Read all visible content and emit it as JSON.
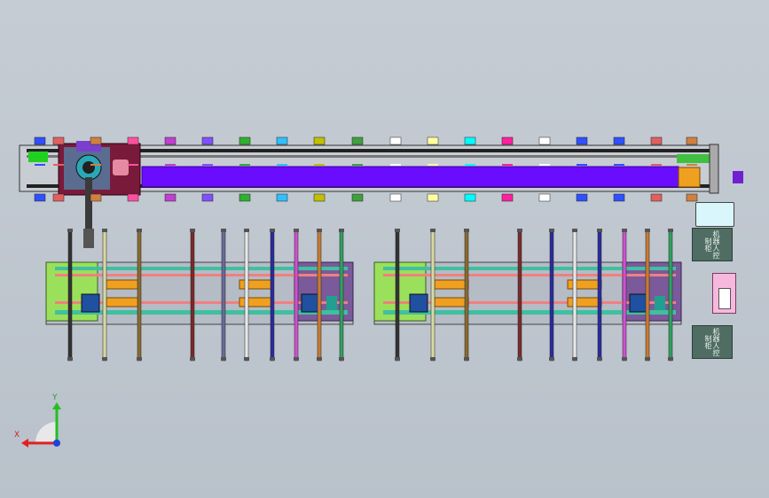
{
  "scene": {
    "type": "cad-plan-view",
    "background_color": "#bfc6ce"
  },
  "gantry": {
    "beam_color": "#6a0dff",
    "carriage_color": "#7a1a3a",
    "end_block_color": "#f0a020"
  },
  "rail_tab_colors": [
    "#3050ff",
    "#e06060",
    "#d08040",
    "#ff50a0",
    "#c040d0",
    "#8050ff",
    "#30b030",
    "#30c0ff",
    "#c0c000",
    "#40a040",
    "#ffffff",
    "#ffffa0",
    "#00ffff",
    "#ff20a0",
    "#ffffff",
    "#3050ff"
  ],
  "posts_left_colors": [
    "#333333",
    "#d8d8a0",
    "#8b6a30",
    "#7a2a2a",
    "#6a6a9a",
    "#e8e8e8",
    "#2a2aa0",
    "#d050d0",
    "#c87a30",
    "#30a060"
  ],
  "posts_right_colors": [
    "#333333",
    "#d8d8a0",
    "#8b6a30",
    "#7a2a2a",
    "#2a2aa0",
    "#e8e8e8",
    "#2a2aa0",
    "#d050d0",
    "#c87a30",
    "#30a060"
  ],
  "cabinets": {
    "top_label": "机器人控制柜",
    "bottom_label": "机器人控制柜"
  },
  "triad": {
    "x_label": "X",
    "y_label": "Y"
  }
}
